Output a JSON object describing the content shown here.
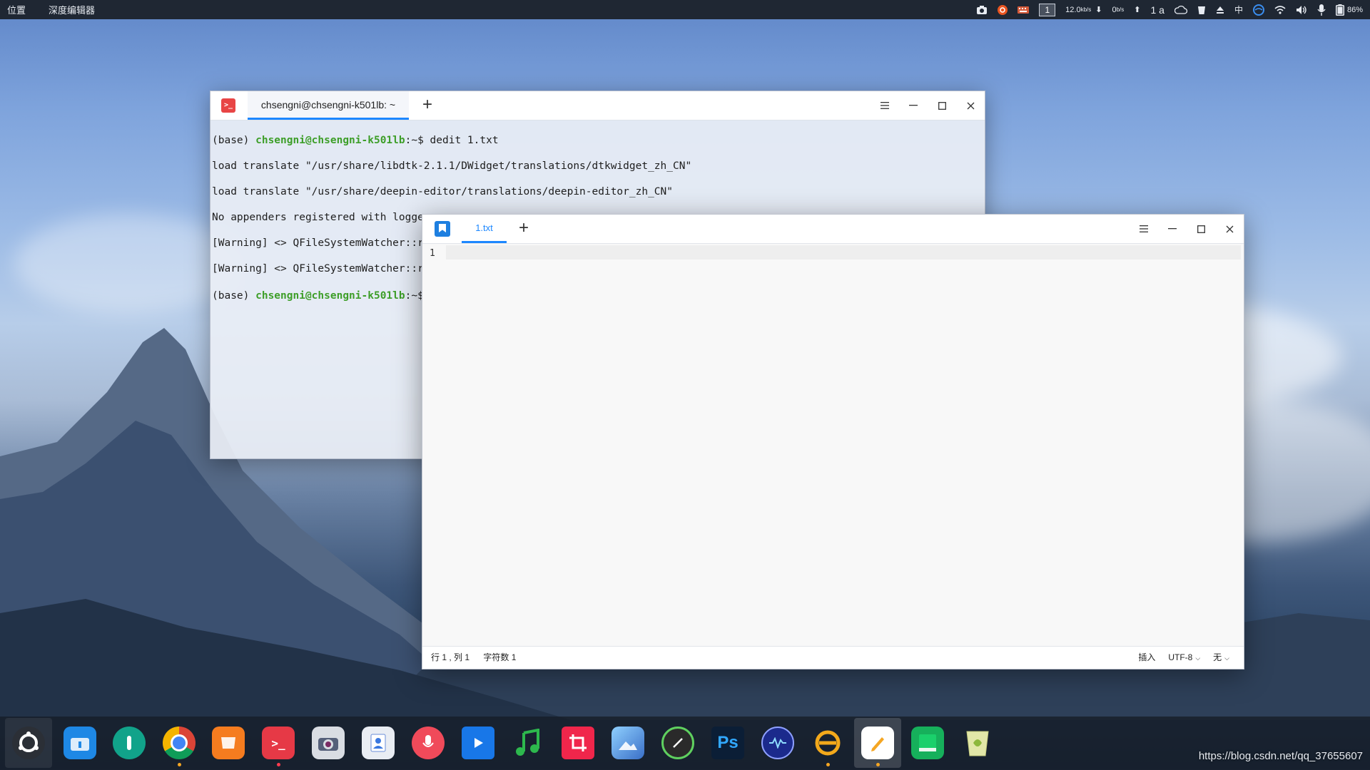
{
  "topbar": {
    "menu_items": [
      "位置",
      "深度编辑器"
    ],
    "workspace_number": "1",
    "net_down": "12.0",
    "net_down_unit": "kb/s",
    "net_up": "0",
    "net_up_unit": "b/s",
    "indicator_text": "1 a",
    "ime": "中",
    "battery": "86%"
  },
  "terminal": {
    "tab_title": "chsengni@chsengni-k501lb: ~",
    "lines": [
      {
        "pre": "(base) ",
        "user": "chsengni@chsengni-k501lb",
        "post": ":~$ dedit 1.txt"
      },
      {
        "text": "load translate \"/usr/share/libdtk-2.1.1/DWidget/translations/dtkwidget_zh_CN\""
      },
      {
        "text": "load translate \"/usr/share/deepin-editor/translations/deepin-editor_zh_CN\""
      },
      {
        "text": "No appenders registered with logger"
      },
      {
        "text": "[Warning] <> QFileSystemWatcher::removePaths: list is empty"
      },
      {
        "text": "[Warning] <> QFileSystemWatcher::removePaths: list is empty"
      },
      {
        "pre": "(base) ",
        "user": "chsengni@chsengni-k501lb",
        "post": ":~$ "
      }
    ]
  },
  "editor": {
    "tab_title": "1.txt",
    "line_number": "1",
    "status": {
      "position": "行 1 , 列 1",
      "char_count": "字符数 1",
      "mode": "插入",
      "encoding": "UTF-8",
      "highlight": "无"
    }
  },
  "dock": {
    "items": [
      {
        "name": "launcher-icon",
        "color": "#2b2f36"
      },
      {
        "name": "file-manager-icon",
        "color": "#1e88e5"
      },
      {
        "name": "control-center-icon",
        "color": "#11a38a"
      },
      {
        "name": "chrome-icon",
        "color": "#ffffff"
      },
      {
        "name": "app-store-icon",
        "color": "#f57c1f"
      },
      {
        "name": "terminal-icon",
        "color": "#e63946"
      },
      {
        "name": "camera-icon",
        "color": "#d9dde3"
      },
      {
        "name": "contacts-icon",
        "color": "#e9edf3"
      },
      {
        "name": "voice-recorder-icon",
        "color": "#f04a5a"
      },
      {
        "name": "movie-icon",
        "color": "#1877e8"
      },
      {
        "name": "music-icon",
        "color": "#2db84d"
      },
      {
        "name": "screenshot-icon",
        "color": "#f0264b"
      },
      {
        "name": "image-viewer-icon",
        "color": "#5aa7e8"
      },
      {
        "name": "system-monitor-icon",
        "color": "#2a2a2a"
      },
      {
        "name": "photoshop-icon",
        "color": "#0b1e36"
      },
      {
        "name": "audio-monitor-icon",
        "color": "#1b2a8c"
      },
      {
        "name": "sunlogin-icon",
        "color": "#f3a91b"
      },
      {
        "name": "text-editor-icon",
        "color": "#ffffff"
      },
      {
        "name": "notes-icon",
        "color": "#16b05b"
      },
      {
        "name": "trash-icon",
        "color": "#e2e7a8"
      }
    ],
    "photoshop_label": "Ps"
  },
  "watermark": "https://blog.csdn.net/qq_37655607",
  "colors": {
    "accent": "#1c87ff",
    "terminal_user": "#3d9e28",
    "running_dot_orange": "#f5a623",
    "running_dot_red": "#ff3b4e"
  }
}
